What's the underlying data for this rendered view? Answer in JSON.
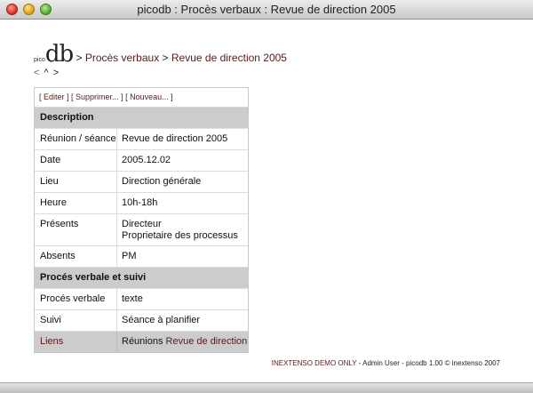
{
  "window": {
    "title": "picodb : Procès verbaux : Revue de direction 2005"
  },
  "brand": {
    "prefix": "pico",
    "main": "db"
  },
  "breadcrumb": {
    "sep1": " > ",
    "item1": "Procès verbaux",
    "sep2": " > ",
    "item2": "Revue de direction 2005"
  },
  "nav": {
    "prev": "<",
    "up": "^",
    "next": ">"
  },
  "actions": {
    "edit": "[ Editer ]",
    "delete": "[ Supprimer... ]",
    "new": "[ Nouveau... ]"
  },
  "sections": {
    "description": "Description",
    "follow_up": "Procés verbale et suivi"
  },
  "fields": [
    {
      "label": "Réunion / séance",
      "value": "Revue de direction 2005"
    },
    {
      "label": "Date",
      "value": "2005.12.02"
    },
    {
      "label": "Lieu",
      "value": "Direction générale"
    },
    {
      "label": "Heure",
      "value": "10h-18h"
    },
    {
      "label": "Présents",
      "value_line1": "Directeur",
      "value_line2": "Proprietaire des processus"
    },
    {
      "label": "Absents",
      "value": "PM"
    },
    {
      "label": "Procés verbale",
      "value": "texte"
    },
    {
      "label": "Suivi",
      "value": "Séance à planifier"
    }
  ],
  "links": {
    "label": "Liens",
    "prefix": "Réunions ",
    "link": "Revue de direction"
  },
  "footer": {
    "demo": "INEXTENSO DEMO ONLY",
    "rest": " - Admin User - picodb 1.00 © inextenso 2007"
  },
  "colors": {
    "link": "#5a1a1a",
    "section_bg": "#cccccc"
  }
}
